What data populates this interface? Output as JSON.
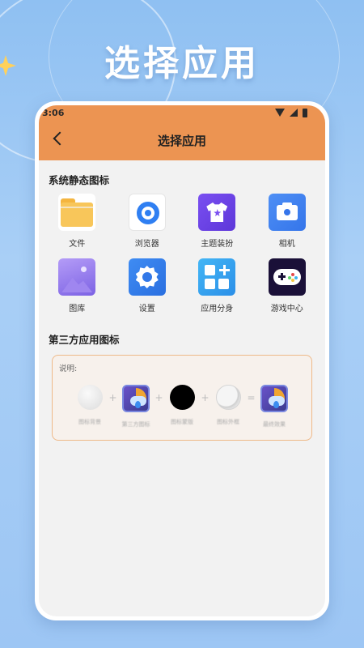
{
  "headline": "选择应用",
  "status": {
    "time": "3:06"
  },
  "appbar": {
    "title": "选择应用"
  },
  "system_section": {
    "title": "系统静态图标",
    "apps": [
      {
        "label": "文件",
        "icon": "folder-icon"
      },
      {
        "label": "浏览器",
        "icon": "browser-icon"
      },
      {
        "label": "主题装扮",
        "icon": "theme-shirt-icon"
      },
      {
        "label": "相机",
        "icon": "camera-icon"
      },
      {
        "label": "图库",
        "icon": "gallery-icon"
      },
      {
        "label": "设置",
        "icon": "settings-gear-icon"
      },
      {
        "label": "应用分身",
        "icon": "app-clone-icon"
      },
      {
        "label": "游戏中心",
        "icon": "gamepad-icon"
      }
    ]
  },
  "third_party_section": {
    "title": "第三方应用图标",
    "note_label": "说明:",
    "operators": [
      "+",
      "+",
      "+",
      "="
    ],
    "captions": [
      "图标背景",
      "第三方图标",
      "图标蒙版",
      "图标外框",
      "最终效果"
    ]
  },
  "colors": {
    "appbar": "#ec9452",
    "note_border": "#eeb989"
  }
}
